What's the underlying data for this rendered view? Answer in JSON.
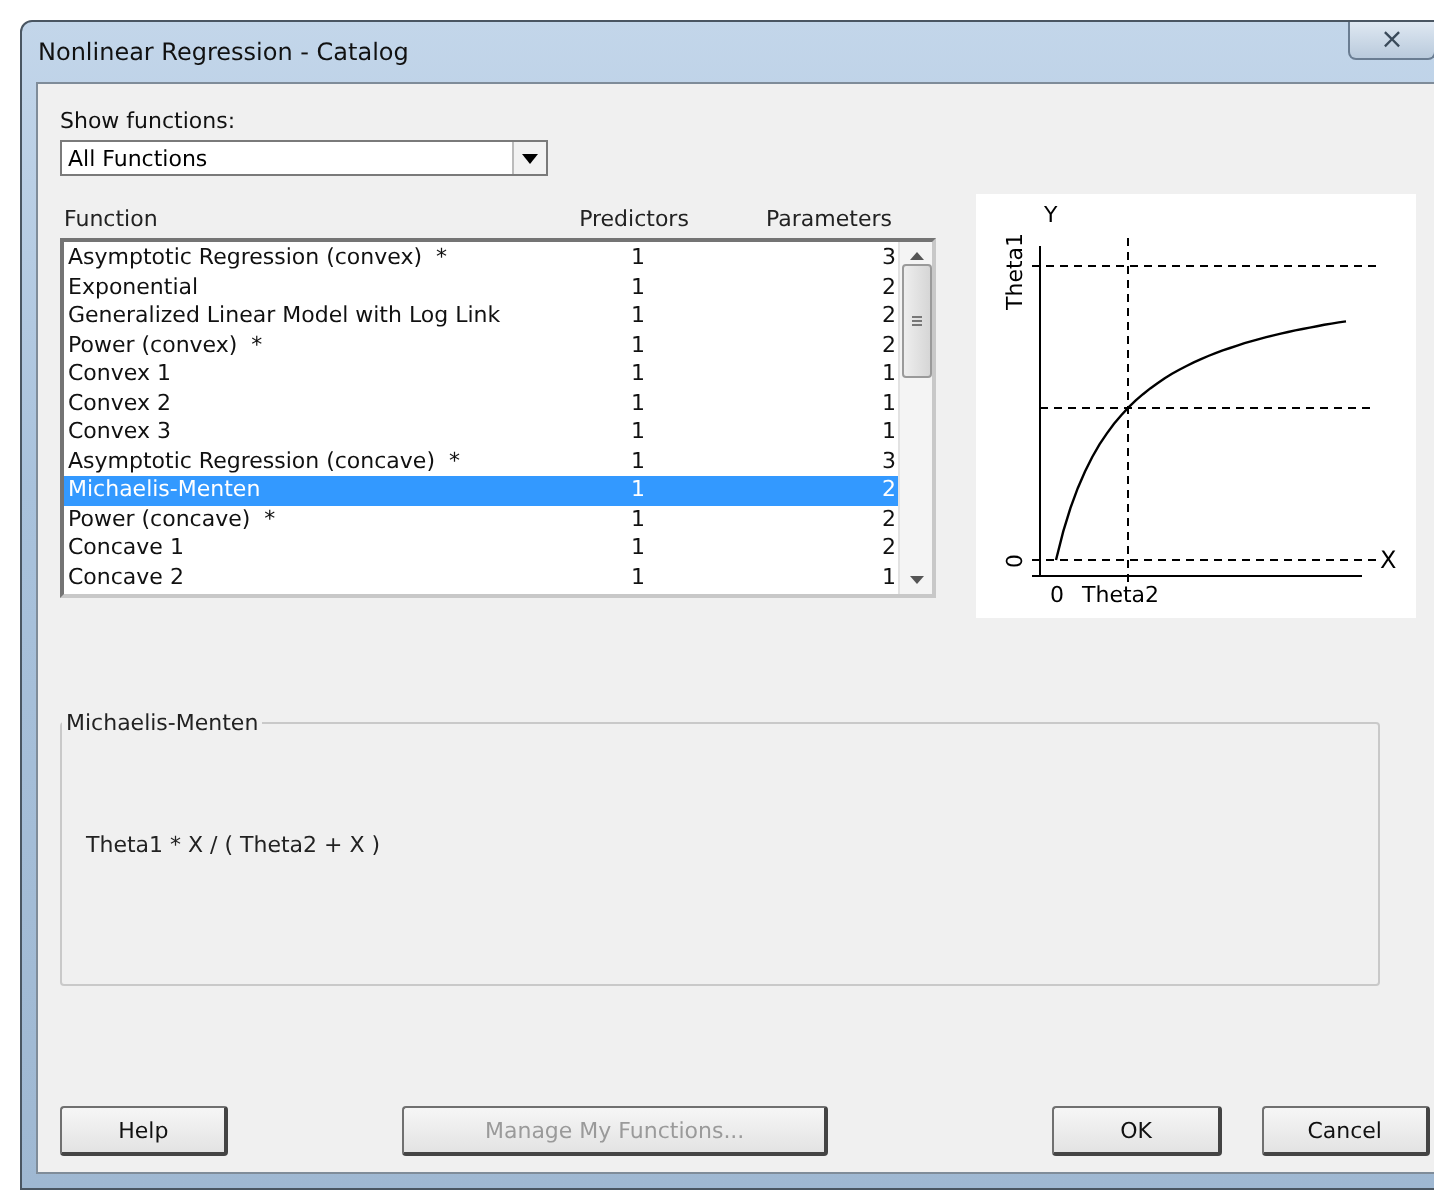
{
  "window": {
    "title": "Nonlinear Regression - Catalog",
    "close_icon": "×"
  },
  "show_functions": {
    "label": "Show functions:",
    "value": "All Functions"
  },
  "table": {
    "columns": [
      "Function",
      "Predictors",
      "Parameters"
    ],
    "rows": [
      {
        "name": "Asymptotic Regression (convex)  *",
        "predictors": "1",
        "parameters": "3",
        "selected": false
      },
      {
        "name": "Exponential",
        "predictors": "1",
        "parameters": "2",
        "selected": false
      },
      {
        "name": "Generalized Linear Model with Log Link",
        "predictors": "1",
        "parameters": "2",
        "selected": false
      },
      {
        "name": "Power (convex)  *",
        "predictors": "1",
        "parameters": "2",
        "selected": false
      },
      {
        "name": "Convex 1",
        "predictors": "1",
        "parameters": "1",
        "selected": false
      },
      {
        "name": "Convex 2",
        "predictors": "1",
        "parameters": "1",
        "selected": false
      },
      {
        "name": "Convex 3",
        "predictors": "1",
        "parameters": "1",
        "selected": false
      },
      {
        "name": "Asymptotic Regression (concave)  *",
        "predictors": "1",
        "parameters": "3",
        "selected": false
      },
      {
        "name": "Michaelis-Menten",
        "predictors": "1",
        "parameters": "2",
        "selected": true
      },
      {
        "name": "Power (concave)  *",
        "predictors": "1",
        "parameters": "2",
        "selected": false
      },
      {
        "name": "Concave 1",
        "predictors": "1",
        "parameters": "2",
        "selected": false
      },
      {
        "name": "Concave 2",
        "predictors": "1",
        "parameters": "1",
        "selected": false
      }
    ]
  },
  "diagram": {
    "y_axis": "Y",
    "x_axis": "X",
    "y_marker": "Theta1",
    "y_zero": "0",
    "x_zero": "0",
    "x_marker": "Theta2"
  },
  "details": {
    "title": "Michaelis-Menten",
    "formula": "Theta1 * X / ( Theta2 + X )"
  },
  "buttons": [
    {
      "label": "Help",
      "disabled": false
    },
    {
      "label": "Manage My Functions...",
      "disabled": true
    },
    {
      "label": "OK",
      "disabled": false
    },
    {
      "label": "Cancel",
      "disabled": false
    }
  ]
}
